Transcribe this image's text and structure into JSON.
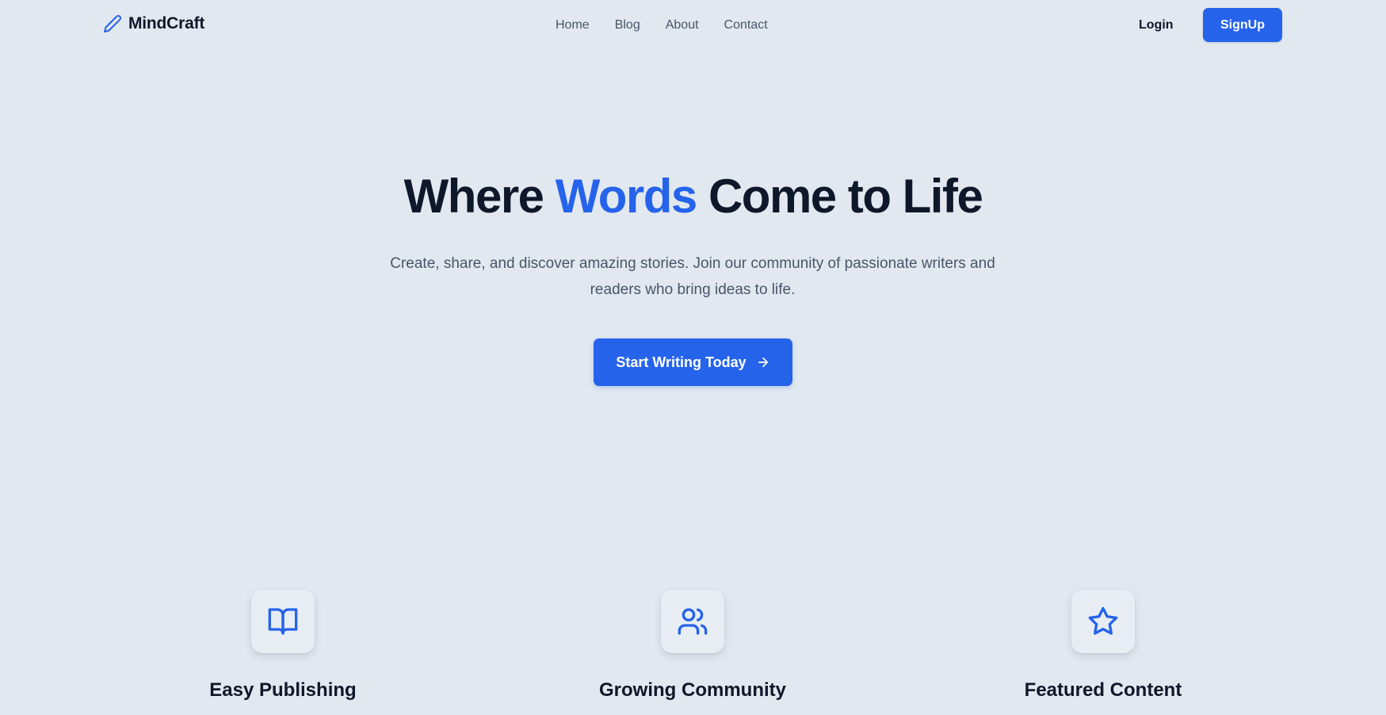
{
  "nav": {
    "brand": {
      "name": "MindCraft",
      "icon": "pencil-icon"
    },
    "links": [
      "Home",
      "Blog",
      "About",
      "Contact"
    ],
    "login_label": "Login",
    "signup_label": "SignUp"
  },
  "hero": {
    "title_before": "Where ",
    "title_accent": "Words",
    "title_after": " Come to Life",
    "subtitle": "Create, share, and discover amazing stories. Join our community of passionate writers and readers who bring ideas to life.",
    "cta_label": "Start Writing Today",
    "cta_icon": "arrow-right-icon"
  },
  "features": [
    {
      "title": "Easy Publishing",
      "icon": "book-open-icon"
    },
    {
      "title": "Growing Community",
      "icon": "users-icon"
    },
    {
      "title": "Featured Content",
      "icon": "star-icon"
    }
  ],
  "colors": {
    "background": "#e2e8f0",
    "primary": "#2563eb",
    "heading": "#0f172a",
    "muted": "#475569"
  }
}
